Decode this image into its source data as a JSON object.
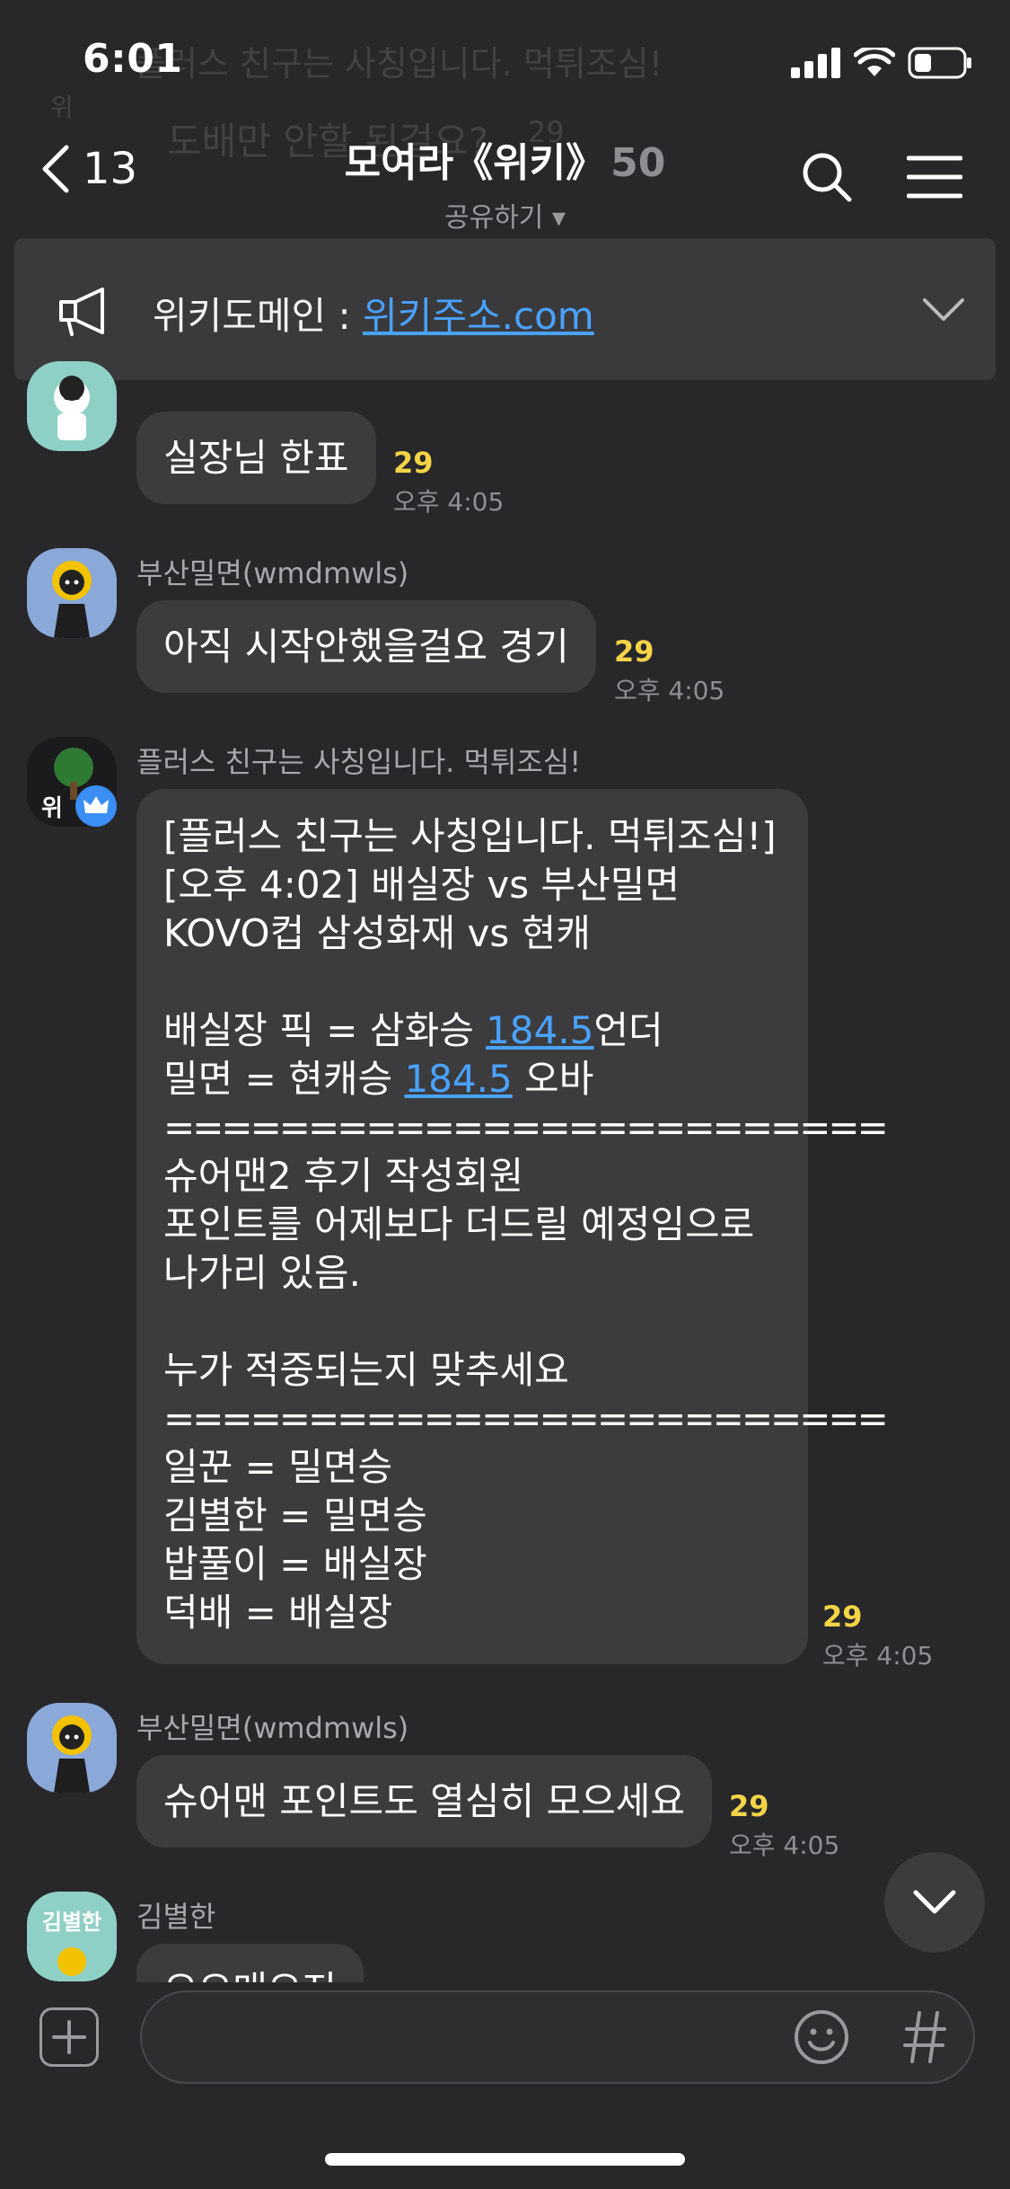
{
  "status_bar": {
    "time": "6:01"
  },
  "background_ghost": {
    "line1": "플러스 친구는 사칭입니다. 먹튀조심!",
    "line2": "위",
    "line3": "도배만 안할 된걸요?",
    "line4": "29"
  },
  "header": {
    "back_count": "13",
    "title": "모여라《위키》",
    "member_count": "50",
    "subtitle": "공유하기 ▾"
  },
  "notice": {
    "label": "위키도메인 : ",
    "link": "위키주소.com"
  },
  "messages": [
    {
      "sender": "",
      "text": "실장님 한표",
      "unread": "29",
      "time": "오후 4:05"
    },
    {
      "sender": "부산밀면(wmdmwls)",
      "text": "아직 시작안했을걸요 경기",
      "unread": "29",
      "time": "오후 4:05"
    },
    {
      "sender": "플러스 친구는 사칭입니다. 먹튀조심!",
      "avatar_text": "위",
      "lines": {
        "l1": "[플러스 친구는 사칭입니다. 먹튀조심!]",
        "l2": "[오후 4:02] 배실장 vs 부산밀면",
        "l3": "KOVO컵 삼성화재 vs 현캐",
        "l4a": "배실장 픽 = 삼화승 ",
        "l4link": "184.5",
        "l4b": "언더",
        "l5a": "밀면 = 현캐승 ",
        "l5link": "184.5",
        "l5b": " 오바",
        "sep1": "=========================",
        "l6": "슈어맨2 후기 작성회원",
        "l7": "포인트를 어제보다 더드릴 예정임으로",
        "l8": "나가리 있음.",
        "l9": "누가 적중되는지 맞추세요",
        "sep2": "=========================",
        "l10": "일꾼 = 밀면승",
        "l11": "김별한 = 밀면승",
        "l12": "밥풀이 = 배실장",
        "l13": "덕배 = 배실장"
      },
      "unread": "29",
      "time": "오후 4:05"
    },
    {
      "sender": "부산밀면(wmdmwls)",
      "text": "슈어맨 포인트도 열심히 모으세요",
      "unread": "29",
      "time": "오후 4:05"
    },
    {
      "sender": "김별한",
      "avatar_text": "김별한",
      "text": "오오매오지"
    }
  ],
  "input": {
    "placeholder": ""
  },
  "colors": {
    "background": "#28282b",
    "bubble": "#3c3c3f",
    "unread": "#f5d547",
    "link": "#4aa3ff"
  },
  "icons": [
    "back-chevron-icon",
    "search-icon",
    "menu-icon",
    "megaphone-icon",
    "chevron-down-icon",
    "plus-icon",
    "emoji-icon",
    "hash-icon"
  ]
}
